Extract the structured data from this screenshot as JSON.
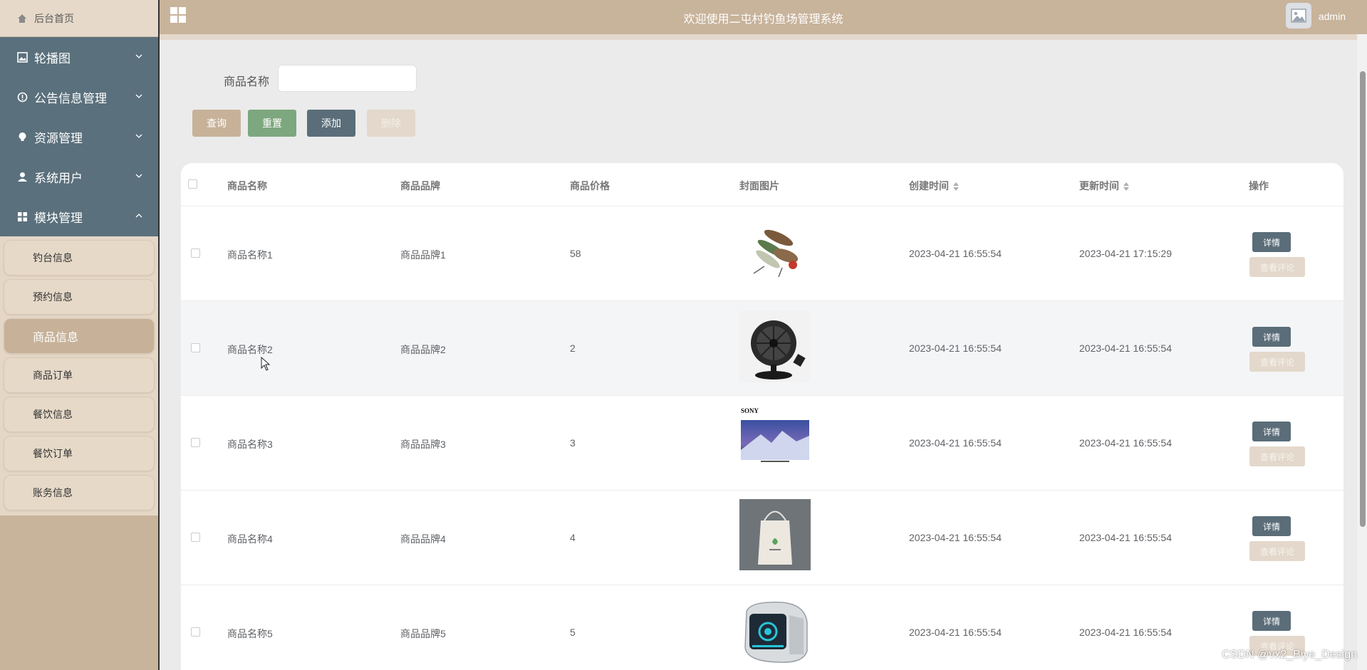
{
  "header": {
    "title": "欢迎使用二屯村钓鱼场管理系统",
    "username": "admin"
  },
  "sidebar": {
    "home": "后台首页",
    "menus": [
      {
        "label": "轮播图",
        "icon": "picture-icon"
      },
      {
        "label": "公告信息管理",
        "icon": "info-circle-icon"
      },
      {
        "label": "资源管理",
        "icon": "lightbulb-icon"
      },
      {
        "label": "系统用户",
        "icon": "user-icon"
      },
      {
        "label": "模块管理",
        "icon": "grid-icon"
      }
    ],
    "submenu": [
      "钓台信息",
      "预约信息",
      "商品信息",
      "商品订单",
      "餐饮信息",
      "餐饮订单",
      "账务信息"
    ]
  },
  "search": {
    "label": "商品名称",
    "value": "",
    "placeholder": ""
  },
  "buttons": {
    "query": "查询",
    "reset": "重置",
    "add": "添加",
    "delete": "删除"
  },
  "table": {
    "columns": [
      "商品名称",
      "商品品牌",
      "商品价格",
      "封面图片",
      "创建时间",
      "更新时间",
      "操作"
    ],
    "rows": [
      {
        "name": "商品名称1",
        "brand": "商品品牌1",
        "price": "58",
        "image": "fishing-lures",
        "created": "2023-04-21 16:55:54",
        "updated": "2023-04-21 17:15:29"
      },
      {
        "name": "商品名称2",
        "brand": "商品品牌2",
        "price": "2",
        "image": "desk-fan",
        "created": "2023-04-21 16:55:54",
        "updated": "2023-04-21 16:55:54"
      },
      {
        "name": "商品名称3",
        "brand": "商品品牌3",
        "price": "3",
        "image": "sony-tv",
        "sony": "SONY",
        "created": "2023-04-21 16:55:54",
        "updated": "2023-04-21 16:55:54"
      },
      {
        "name": "商品名称4",
        "brand": "商品品牌4",
        "price": "4",
        "image": "tote-bag",
        "created": "2023-04-21 16:55:54",
        "updated": "2023-04-21 16:55:54"
      },
      {
        "name": "商品名称5",
        "brand": "商品品牌5",
        "price": "5",
        "image": "gaming-pc",
        "created": "2023-04-21 16:55:54",
        "updated": "2023-04-21 16:55:54"
      }
    ],
    "actions": {
      "detail": "详情",
      "comment": "查看评论"
    }
  },
  "watermark": "CSDN @vx2_Biye_Design",
  "colors": {
    "accent": "#c8b39b",
    "sidebar_menu": "#5a707c",
    "reset_green": "#7da77e",
    "dark_button": "#5a6d79"
  }
}
